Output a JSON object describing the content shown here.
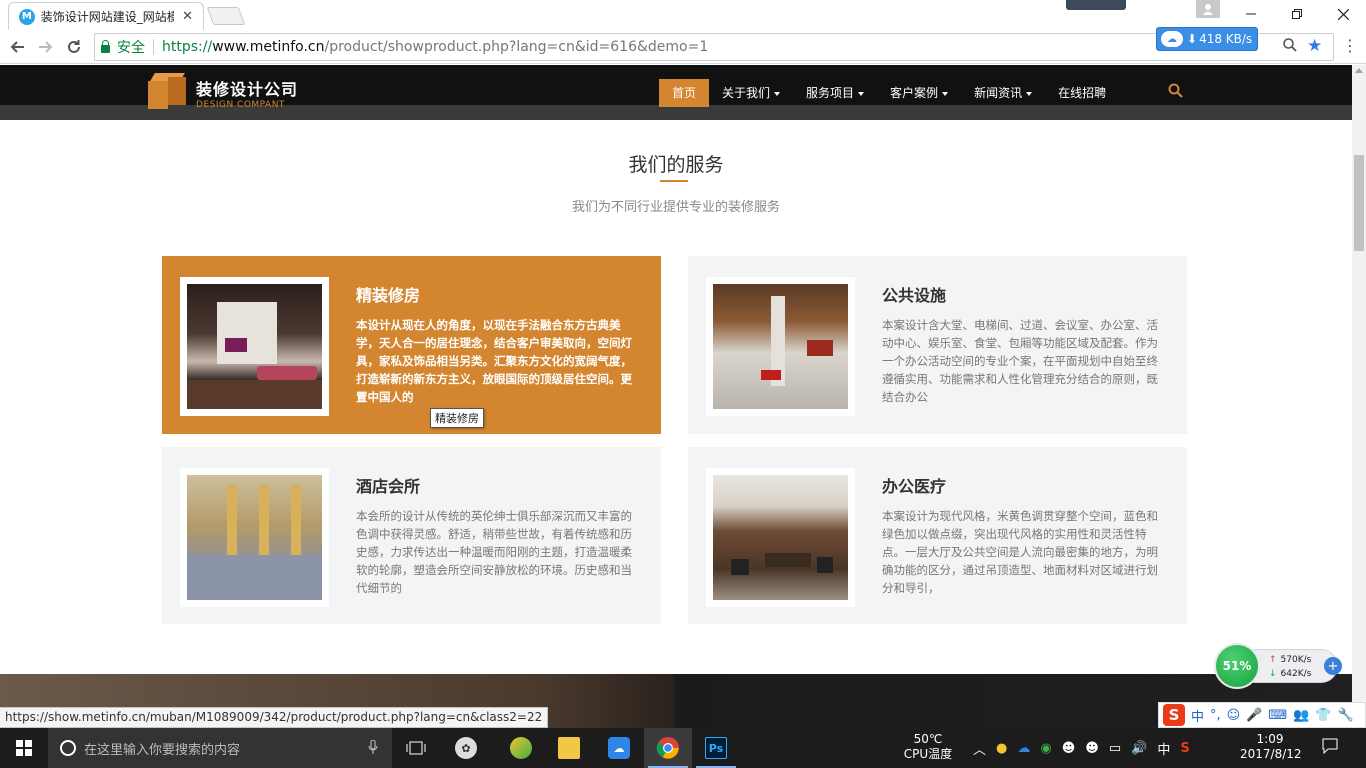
{
  "browser": {
    "tab_title": "装饰设计网站建设_网站模",
    "tab_favicon": "M",
    "tab_close": "✕",
    "secure_label": "安全",
    "url_scheme": "https://",
    "url_host": "www.metinfo.cn",
    "url_path": "/product/showproduct.php?lang=cn&id=616&demo=1",
    "speed": "418 KB/s",
    "status_url": "https://show.metinfo.cn/muban/M1089009/342/product/product.php?lang=cn&class2=22"
  },
  "site": {
    "logo_title": "装修设计公司",
    "logo_sub": "DESIGN COMPANT",
    "nav": [
      {
        "label": "首页",
        "active": true,
        "dropdown": false
      },
      {
        "label": "关于我们",
        "active": false,
        "dropdown": true
      },
      {
        "label": "服务项目",
        "active": false,
        "dropdown": true
      },
      {
        "label": "客户案例",
        "active": false,
        "dropdown": true
      },
      {
        "label": "新闻资讯",
        "active": false,
        "dropdown": true
      },
      {
        "label": "在线招聘",
        "active": false,
        "dropdown": false
      }
    ],
    "accent_color": "#d4852f"
  },
  "services": {
    "title": "我们的服务",
    "subtitle": "我们为不同行业提供专业的装修服务",
    "cards": [
      {
        "title": "精装修房",
        "desc": "本设计从现在人的角度，以现在手法融合东方古典美学，天人合一的居住理念，结合客户审美取向，空间灯具，家私及饰品相当另类。汇聚东方文化的宽阔气度，打造崭新的新东方主义，放眼国际的顶级居住空间。更置中国人的",
        "active": true
      },
      {
        "title": "公共设施",
        "desc": "本案设计含大堂、电梯间、过道、会议室、办公室、活动中心、娱乐室、食堂、包厢等功能区域及配套。作为一个办公活动空间的专业个案，在平面规划中自始至终遵循实用、功能需求和人性化管理充分结合的原则，既结合办公",
        "active": false
      },
      {
        "title": "酒店会所",
        "desc": "本会所的设计从传统的英伦绅士俱乐部深沉而又丰富的色调中获得灵感。舒适，稍带些世故，有着传统感和历史感，力求传达出一种温暖而阳刚的主题，打造温暖柔软的轮廓，塑造会所空间安静放松的环境。历史感和当代细节的",
        "active": false
      },
      {
        "title": "办公医疗",
        "desc": "本案设计为现代风格，米黄色调贯穿整个空间，蓝色和绿色加以做点缀，突出现代风格的实用性和灵活性特点。一层大厅及公共空间是人流向最密集的地方，为明确功能的区分，通过吊顶造型、地面材料对区域进行划分和导引，",
        "active": false
      }
    ],
    "tooltip": "精装修房"
  },
  "widgets": {
    "net_percent": "51%",
    "net_up": "570K/s",
    "net_down": "642K/s",
    "ime_items": [
      "中",
      "°,",
      "☺",
      "🎤",
      "⌨",
      "👥",
      "👕",
      "🔧"
    ]
  },
  "taskbar": {
    "search_placeholder": "在这里输入你要搜索的内容",
    "cpu_temp": "50℃",
    "cpu_label": "CPU温度",
    "input_lang": "中",
    "time": "1:09",
    "date": "2017/8/12"
  }
}
